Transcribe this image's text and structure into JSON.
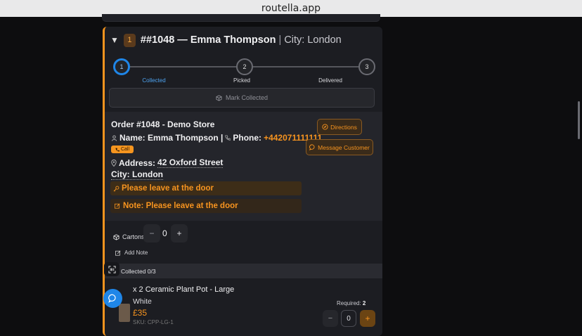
{
  "browser": {
    "url": "routella.app"
  },
  "order_card": {
    "collapse_glyph": "▼",
    "index": "1",
    "order_ref": "##1048 — Emma Thompson",
    "separator": "|",
    "city_label": "City: London",
    "steps": [
      {
        "num": "1",
        "label": "Collected",
        "active": true
      },
      {
        "num": "2",
        "label": "Picked",
        "active": false
      },
      {
        "num": "3",
        "label": "Delivered",
        "active": false
      }
    ],
    "mark_button": "Mark Collected",
    "info": {
      "order_line": "Order #1048 - Demo Store",
      "name_label": "Name: Emma Thompson |",
      "phone_label": "Phone:",
      "phone": "+442071111111",
      "call_button": "Call",
      "address_label": "Address:",
      "address": "42 Oxford Street",
      "city_line": "City: London",
      "delivery_instruction": "Please leave at the door",
      "note": "Note: Please leave at the door",
      "directions_button": "Directions",
      "message_button": "Message Customer"
    },
    "cartons": {
      "label": "Cartons",
      "minus": "−",
      "value": "0",
      "plus": "+"
    },
    "add_note": "Add Note",
    "collected_status": "Collected 0/3",
    "items": [
      {
        "name": "x 2 Ceramic Plant Pot - Large",
        "variant": "White",
        "price": "£35",
        "sku": "SKU: CPP-LG-1",
        "required_label": "Required:",
        "required": "2",
        "qty_minus": "−",
        "qty": "0",
        "qty_plus": "+"
      }
    ]
  },
  "colors": {
    "accent": "#f7941f",
    "active_step": "#1f86e8",
    "background": "#0d0d0f",
    "card": "#1c1d22"
  }
}
